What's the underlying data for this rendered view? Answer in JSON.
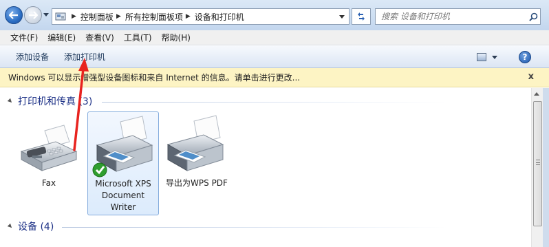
{
  "window": {
    "breadcrumbs": [
      "控制面板",
      "所有控制面板项",
      "设备和打印机"
    ],
    "search_placeholder": "搜索 设备和打印机"
  },
  "menu": [
    "文件(F)",
    "编辑(E)",
    "查看(V)",
    "工具(T)",
    "帮助(H)"
  ],
  "commandbar": {
    "add_device": "添加设备",
    "add_printer": "添加打印机",
    "help": "?"
  },
  "infobar": {
    "text": "Windows 可以显示增强型设备图标和来自 Internet 的信息。请单击进行更改...",
    "close": "x"
  },
  "groups": {
    "printers": {
      "title": "打印机和传真 (3)",
      "items": [
        {
          "label": "Fax",
          "icon": "fax-icon"
        },
        {
          "label": "Microsoft XPS Document Writer",
          "icon": "printer-icon",
          "default": true
        },
        {
          "label": "导出为WPS PDF",
          "icon": "printer-icon"
        }
      ]
    },
    "devices": {
      "title": "设备 (4)"
    }
  },
  "colors": {
    "annotation_arrow": "#e8231f",
    "group_title": "#1e3287",
    "infobar_bg": "#fdf4c4"
  }
}
